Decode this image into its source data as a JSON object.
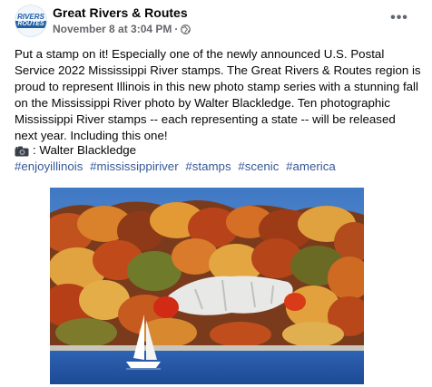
{
  "post": {
    "avatar_text": [
      "RIVERS",
      "ROUTES"
    ],
    "page_name": "Great Rivers & Routes",
    "timestamp": "November 8 at 3:04 PM",
    "separator": "·",
    "privacy_icon": "globe-icon",
    "more_label": "•••",
    "body": "Put a stamp on it! Especially one of the newly announced U.S. Postal Service 2022 Mississippi River stamps. The Great Rivers & Routes region is proud to represent Illinois in this new photo stamp series with a stunning fall on the Mississippi River photo by Walter Blackledge. Ten photographic Mississippi River stamps -- each representing a state -- will be released next year. Including this one!",
    "credit_icon": "camera-icon",
    "credit": ": Walter Blackledge",
    "hashtags": [
      "#enjoyillinois",
      "#mississippiriver",
      "#stamps",
      "#scenic",
      "#america"
    ],
    "photo_subject": "autumn bluffs with sailboat on river"
  },
  "colors": {
    "link": "#385898",
    "secondary_text": "#65676b",
    "primary_text": "#050505"
  }
}
